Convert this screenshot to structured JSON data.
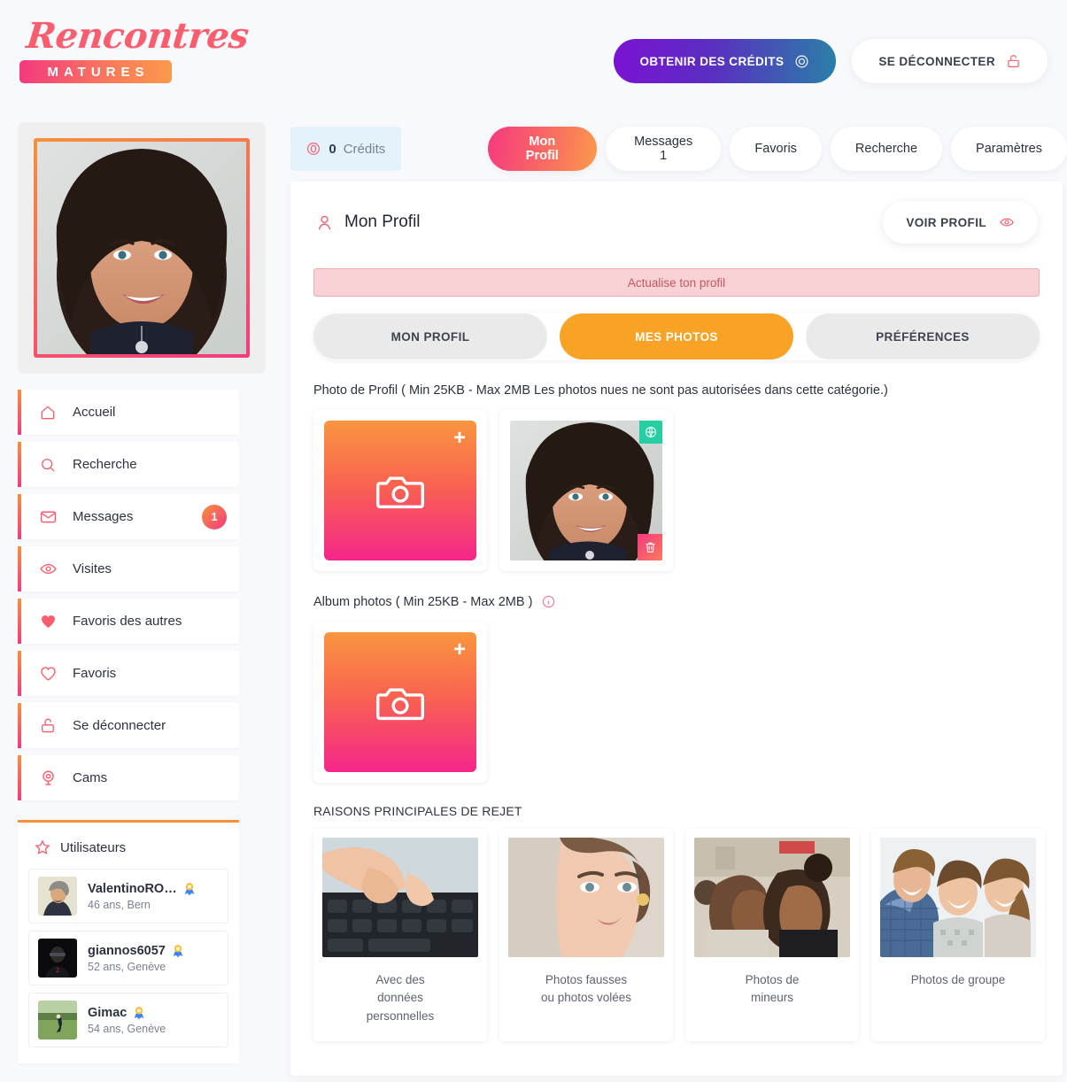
{
  "brand": {
    "name": "Rencontres",
    "tagline": "MATURES"
  },
  "header": {
    "credits_button": "OBTENIR DES CRÉDITS",
    "logout_button": "SE DÉCONNECTER"
  },
  "credits": {
    "count": "0",
    "label": "Crédits"
  },
  "tabs": [
    {
      "label": "Mon Profil",
      "active": true
    },
    {
      "label": "Messages 1",
      "active": false
    },
    {
      "label": "Favoris",
      "active": false
    },
    {
      "label": "Recherche",
      "active": false
    },
    {
      "label": "Paramètres",
      "active": false
    }
  ],
  "sidebar": {
    "items": [
      {
        "label": "Accueil",
        "icon": "home-icon",
        "badge": ""
      },
      {
        "label": "Recherche",
        "icon": "search-icon",
        "badge": ""
      },
      {
        "label": "Messages",
        "icon": "mail-icon",
        "badge": "1"
      },
      {
        "label": "Visites",
        "icon": "eye-icon",
        "badge": ""
      },
      {
        "label": "Favoris des autres",
        "icon": "heart-filled-icon",
        "badge": ""
      },
      {
        "label": "Favoris",
        "icon": "heart-outline-icon",
        "badge": ""
      },
      {
        "label": "Se déconnecter",
        "icon": "unlock-icon",
        "badge": ""
      },
      {
        "label": "Cams",
        "icon": "webcam-icon",
        "badge": ""
      }
    ],
    "users_title": "Utilisateurs",
    "users": [
      {
        "name": "ValentinoRO…",
        "meta": "46 ans, Bern",
        "badge": "medal-icon"
      },
      {
        "name": "giannos6057",
        "meta": "52 ans, Genève",
        "badge": "medal-icon"
      },
      {
        "name": "Gimac",
        "meta": "54 ans, Genève",
        "badge": "medal-icon"
      }
    ]
  },
  "panel": {
    "title": "Mon Profil",
    "view_profile_button": "VOIR PROFIL",
    "alert": "Actualise ton profil",
    "subtabs": [
      {
        "label": "MON PROFIL",
        "active": false
      },
      {
        "label": "MES PHOTOS",
        "active": true
      },
      {
        "label": "PRÉFÉRENCES",
        "active": false
      }
    ],
    "profile_photo_label": "Photo de Profil ( Min 25KB - Max 2MB Les photos nues ne sont pas autorisées dans cette catégorie.)",
    "album_label": "Album photos ( Min 25KB - Max 2MB )",
    "reject_title": "RAISONS PRINCIPALES DE REJET",
    "reject_cards": [
      {
        "caption": "Avec des\ndonnées\npersonnelles",
        "image": "hands-typing-keyboard"
      },
      {
        "caption": "Photos fausses\nou photos volées",
        "image": "woman-portrait"
      },
      {
        "caption": "Photos de\nmineurs",
        "image": "two-young-women"
      },
      {
        "caption": "Photos de groupe",
        "image": "group-selfie"
      }
    ]
  },
  "colors": {
    "accent_pink": "#f5397f",
    "accent_orange": "#fb9a4c",
    "coral": "#fa5e6e",
    "orange_active": "#f9a326",
    "teal": "#25cfa1",
    "purple": "#7a12d4",
    "page_bg": "#f8f9fc"
  }
}
